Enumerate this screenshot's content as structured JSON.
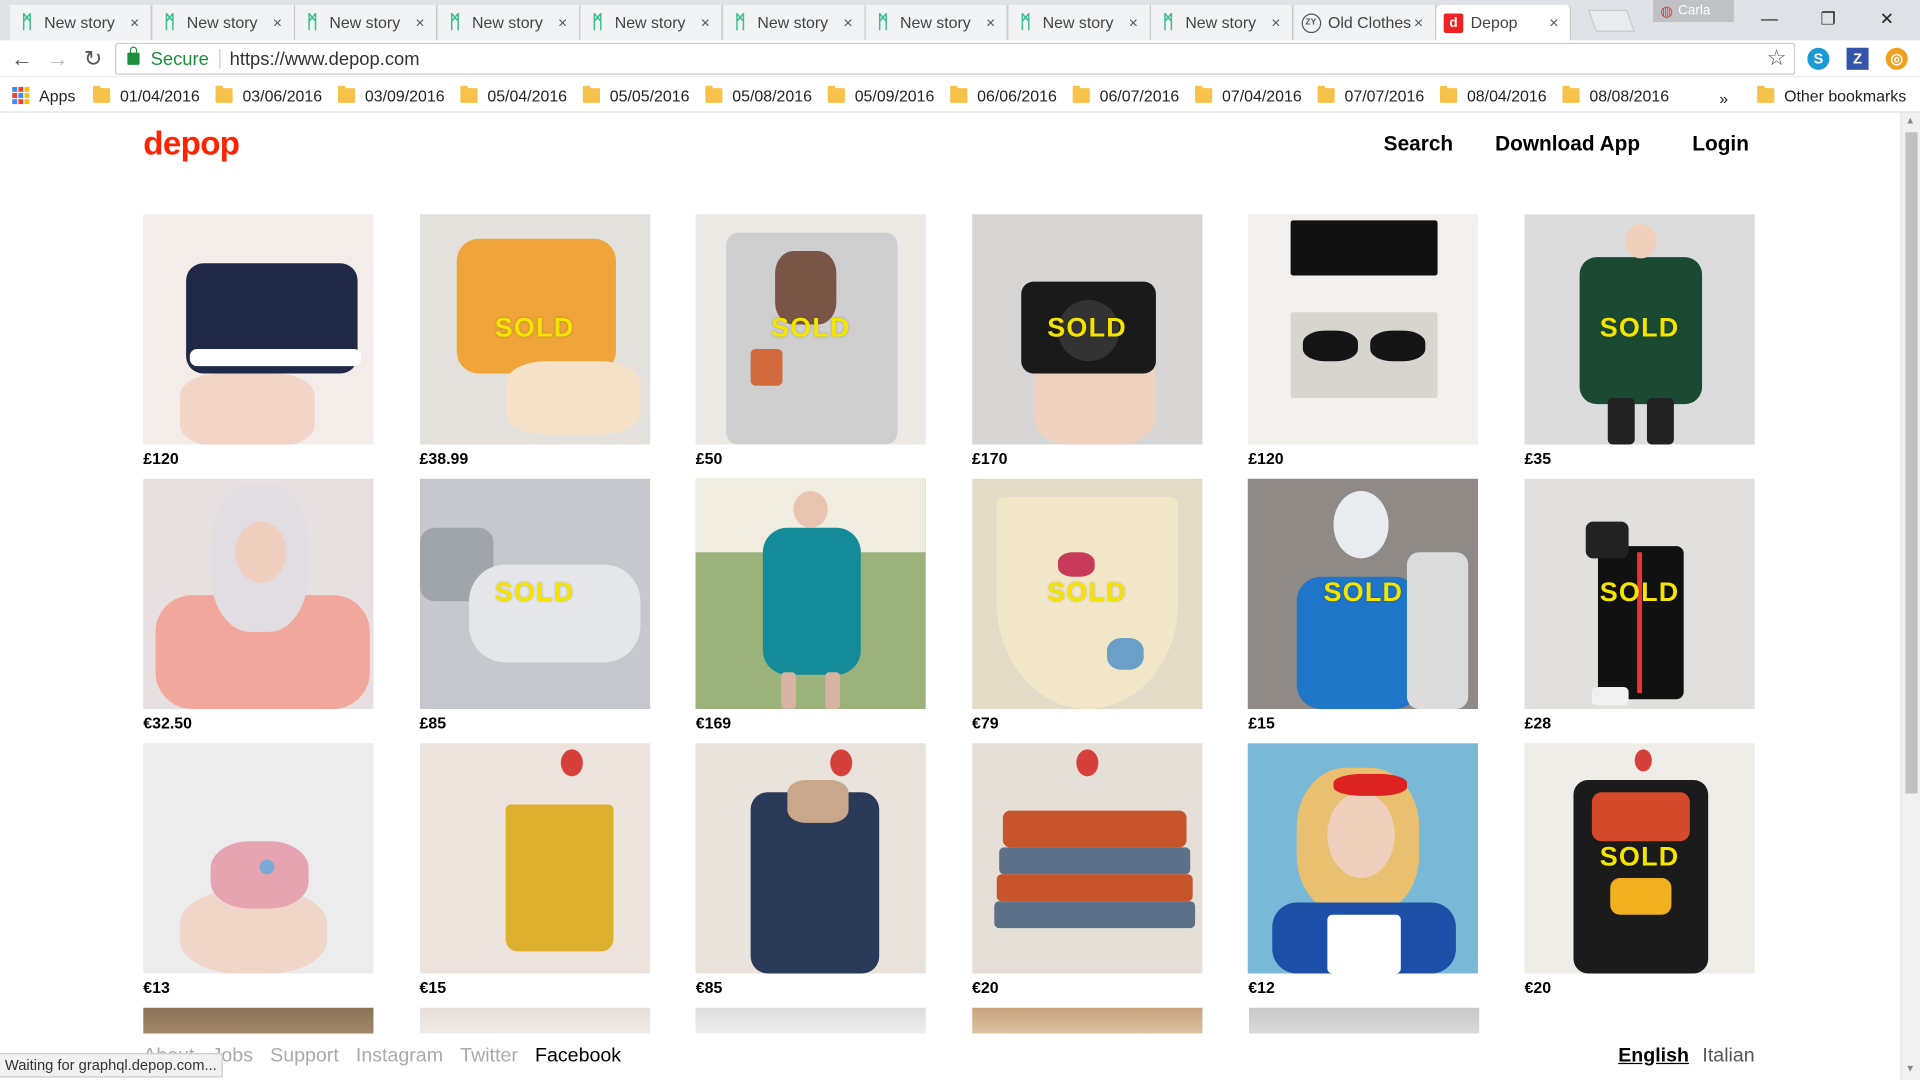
{
  "browser": {
    "tabs": [
      {
        "title": "New story",
        "icon": "medium-m-icon"
      },
      {
        "title": "New story",
        "icon": "medium-m-icon"
      },
      {
        "title": "New story",
        "icon": "medium-m-icon"
      },
      {
        "title": "New story",
        "icon": "medium-m-icon"
      },
      {
        "title": "New story",
        "icon": "medium-m-icon"
      },
      {
        "title": "New story",
        "icon": "medium-m-icon"
      },
      {
        "title": "New story",
        "icon": "medium-m-icon"
      },
      {
        "title": "New story",
        "icon": "medium-m-icon"
      },
      {
        "title": "New story",
        "icon": "medium-m-icon"
      },
      {
        "title": "Old Clothes",
        "icon": "zy-icon"
      },
      {
        "title": "Depop",
        "icon": "depop-d-icon",
        "active": true
      }
    ],
    "profile_name": "Carla",
    "secure_label": "Secure",
    "url": "https://www.depop.com",
    "apps_label": "Apps",
    "bookmarks": [
      "01/04/2016",
      "03/06/2016",
      "03/09/2016",
      "05/04/2016",
      "05/05/2016",
      "05/08/2016",
      "05/09/2016",
      "06/06/2016",
      "06/07/2016",
      "07/04/2016",
      "07/07/2016",
      "08/04/2016",
      "08/08/2016"
    ],
    "other_bookmarks": "Other bookmarks",
    "more_bookmarks": "»",
    "status_text": "Waiting for graphql.depop.com..."
  },
  "site": {
    "logo": "depop",
    "nav": {
      "search": "Search",
      "download": "Download App",
      "login": "Login"
    },
    "sold_label": "SOLD",
    "products": [
      {
        "price": "£120",
        "sold": false,
        "image": "navy-hightop-sneaker"
      },
      {
        "price": "£38.99",
        "sold": true,
        "image": "mustard-hightop-converse"
      },
      {
        "price": "£50",
        "sold": true,
        "image": "grey-printed-sweatshirt"
      },
      {
        "price": "£170",
        "sold": true,
        "image": "canon-camera-in-hand"
      },
      {
        "price": "£120",
        "sold": false,
        "image": "super-sunglasses"
      },
      {
        "price": "£35",
        "sold": true,
        "image": "green-parka-man"
      },
      {
        "price": "€32.50",
        "sold": false,
        "image": "woman-pink-adidas-top"
      },
      {
        "price": "£85",
        "sold": true,
        "image": "grey-air-max-sneaker"
      },
      {
        "price": "€169",
        "sold": false,
        "image": "teal-coat-dress"
      },
      {
        "price": "€79",
        "sold": true,
        "image": "cream-skirt-hummingbird"
      },
      {
        "price": "£15",
        "sold": true,
        "image": "blue-track-jacket"
      },
      {
        "price": "£28",
        "sold": true,
        "image": "black-track-pants"
      },
      {
        "price": "€13",
        "sold": false,
        "image": "pink-crochet-pig"
      },
      {
        "price": "€15",
        "sold": false,
        "image": "yellow-pleated-skirt"
      },
      {
        "price": "€85",
        "sold": false,
        "image": "denim-shearling-coat"
      },
      {
        "price": "€20",
        "sold": false,
        "image": "striped-suede-skirt"
      },
      {
        "price": "€12",
        "sold": false,
        "image": "woman-red-bandana"
      },
      {
        "price": "€20",
        "sold": true,
        "image": "patterned-dress"
      }
    ],
    "footer": {
      "about": "About",
      "jobs": "Jobs",
      "support": "Support",
      "instagram": "Instagram",
      "twitter": "Twitter",
      "facebook": "Facebook",
      "lang_active": "English",
      "lang_other": "Italian"
    },
    "colors": {
      "brand": "#ff2300",
      "sold": "#f5e400"
    }
  }
}
